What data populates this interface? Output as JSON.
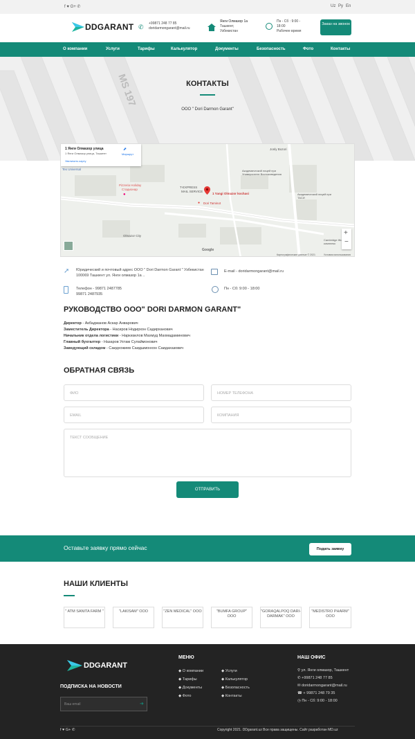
{
  "topbar": {
    "social": "f  ♥  G+  ✆",
    "langs": [
      "Uz",
      "Ру",
      "En"
    ]
  },
  "header": {
    "logo": "DDGARANT",
    "phone": "+99871 248 77 85",
    "email": "doridarmongarant@mail.ru",
    "address1": "Янги Олмазор 1а",
    "address2": "Ташкент,",
    "address3": "Узбекистан",
    "hours1": "Пн - Сб : 9:00 -",
    "hours2": "18:00",
    "hours3": "Рабочее время",
    "call_btn": "Заказ на звонок"
  },
  "nav": [
    "О компании",
    "Услуги",
    "Тарифы",
    "Калькулятор",
    "Документы",
    "Безопасность",
    "Фото",
    "Контакты"
  ],
  "hero": {
    "title": "КОНТАКТЫ",
    "subtitle": "ООО \" Dori Darmon Garant\"",
    "plate": "MS 197"
  },
  "map": {
    "card_title": "1 Янги Олмазор улица",
    "card_sub": "1 Янги Олмазор улица, Ташкент",
    "card_link": "Увеличить карту",
    "card_route": "Маршрут",
    "labels": [
      "Tex Universal",
      "Pizzeria Holiday",
      "Стадионар",
      "T-EXPRESS",
      "MAIL SERVICE",
      "1 Yangi Olmazor kochasi",
      "Dori Taminot",
      "Jonly Bozori",
      "Академический лицей при Университете Востоковедения",
      "Академический лицей при ТАСИ",
      "Olmazor City",
      "Cambridge Жилой комплекс",
      "Google",
      "Картографические данные © 2021",
      "Условия использования"
    ]
  },
  "contact": {
    "address": "Юридический и почтовый адрес ООО \" Dori Darmon Garant \" Узбекистан 100069 Ташкент ул. Янги олмазор 1а ..",
    "email": "E-mail - doridarmongarant@mail.ru",
    "phone": "Телефон - 99871 2487785 99871 2487935",
    "hours": "Пн - Сб: 9:00 - 18:00"
  },
  "leadership": {
    "title": "РУКОВОДСТВО ООО\" DORI DARMON GARANT\"",
    "rows": [
      {
        "role": "Директор",
        "name": " - Акбаджанов Аскар Анварович"
      },
      {
        "role": "Заместитель Директора",
        "name": " - Насиров Нодирхон Садирханович"
      },
      {
        "role": "Начальник отдела логистики",
        "name": " - Наркизилов Махмуд Махмадаминович"
      },
      {
        "role": "Главный бухгалтер",
        "name": " - Назаров Уктам Сулаймонович"
      },
      {
        "role": "Заведующий складом",
        "name": " - Саидхожиев Саидшмонхон Саидахазович"
      }
    ]
  },
  "feedback": {
    "title": "ОБРАТНАЯ СВЯЗЬ",
    "name_ph": "ФИО",
    "phone_ph": "НОМЕР ТЕЛЕФОНА",
    "email_ph": "EMAIL",
    "company_ph": "КОМПАНИЯ",
    "message_ph": "ТЕКСТ СООБЩЕНИЕ",
    "send": "ОТПРАВИТЬ"
  },
  "cta": {
    "text": "Оставьте заявку прямо сейчас",
    "button": "Подать заявку"
  },
  "clients": {
    "title": "НАШИ КЛИЕНТЫ",
    "items": [
      "\" ATM SANITA FARM \"",
      "\"LAKISAM\" ООО",
      "\"ZEN MEDICAL\" ООО",
      "\"BUMFA GROUP\" ООО",
      "\"GORAQALPOQ DARI-DARMAK\" ООО",
      "\"MEDISTRO PHARM\" ООО"
    ]
  },
  "footer": {
    "logo": "DDGARANT",
    "subscribe": "ПОДПИСКА НА НОВОСТИ",
    "email_ph": "Ваш email",
    "menu_title": "МЕНЮ",
    "menu_col1": [
      "О компании",
      "Тарифы",
      "Документы",
      "Фото"
    ],
    "menu_col2": [
      "Услуги",
      "Калькулятор",
      "Безопасность",
      "Контакты"
    ],
    "office_title": "НАШ ОФИС",
    "office": [
      "ул. Янги олмазор, Ташкент",
      "+99871 248 77 85",
      "doridarmongarant@mail.ru",
      "+ 99871 248 79 35",
      "Пн - Сб: 9:00 - 18:00"
    ],
    "copyright": "Copyright 2021. DDgarant.uz Все права защищены. Сайт разработан MD.uz"
  },
  "colors": {
    "accent": "#148a78",
    "dark": "#232323"
  }
}
